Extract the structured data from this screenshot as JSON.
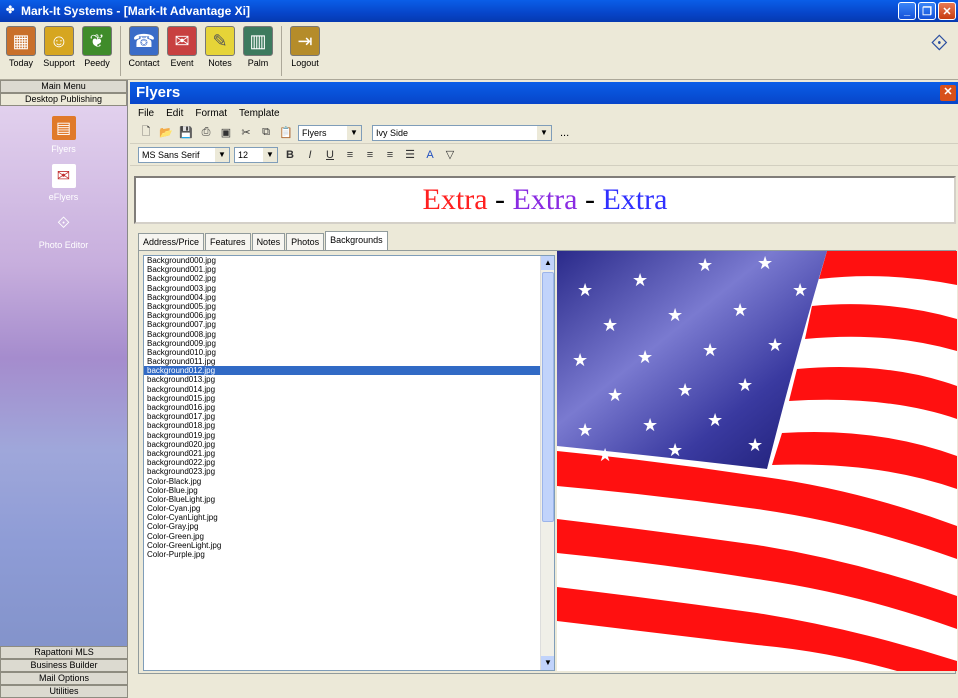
{
  "window": {
    "title": "Mark-It Systems - [Mark-It Advantage Xi]"
  },
  "toolbar": {
    "buttons": [
      {
        "label": "Today",
        "icon": "calendar-icon",
        "color": "#c9702a"
      },
      {
        "label": "Support",
        "icon": "support-icon",
        "color": "#d6a620"
      },
      {
        "label": "Peedy",
        "icon": "parrot-icon",
        "color": "#3f8c2a"
      },
      {
        "label": "Contact",
        "icon": "contact-icon",
        "color": "#3a6cc8"
      },
      {
        "label": "Event",
        "icon": "event-icon",
        "color": "#c84040"
      },
      {
        "label": "Notes",
        "icon": "notes-icon",
        "color": "#e6d438"
      },
      {
        "label": "Palm",
        "icon": "palm-icon",
        "color": "#3d7a5e"
      },
      {
        "label": "Logout",
        "icon": "logout-icon",
        "color": "#b58c2a"
      }
    ]
  },
  "sidebar": {
    "top_buttons": [
      "Main Menu",
      "Desktop Publishing"
    ],
    "items": [
      {
        "label": "Flyers",
        "icon": "flyers-icon"
      },
      {
        "label": "eFlyers",
        "icon": "eflyers-icon"
      },
      {
        "label": "Photo Editor",
        "icon": "photo-editor-icon"
      }
    ],
    "bottom_buttons": [
      "Rapattoni MLS",
      "Business Builder",
      "Mail Options",
      "Utilities"
    ]
  },
  "flyers": {
    "title": "Flyers",
    "menu": [
      "File",
      "Edit",
      "Format",
      "Template"
    ],
    "template_combo": "Flyers",
    "style_combo": "Ivy Side",
    "font_combo": "MS Sans Serif",
    "size_combo": "12",
    "more": "..."
  },
  "banner": {
    "word1": "Extra",
    "sep": " - ",
    "word2": "Extra",
    "word3": "Extra",
    "colors": [
      "#ff2020",
      "#8a2be2",
      "#3030ff"
    ]
  },
  "tabs": [
    "Address/Price",
    "Features",
    "Notes",
    "Photos",
    "Backgrounds"
  ],
  "active_tab": "Backgrounds",
  "backgrounds": [
    "Background000.jpg",
    "Background001.jpg",
    "Background002.jpg",
    "Background003.jpg",
    "Background004.jpg",
    "Background005.jpg",
    "Background006.jpg",
    "Background007.jpg",
    "Background008.jpg",
    "Background009.jpg",
    "Background010.jpg",
    "Background011.jpg",
    "background012.jpg",
    "background013.jpg",
    "background014.jpg",
    "background015.jpg",
    "background016.jpg",
    "background017.jpg",
    "background018.jpg",
    "background019.jpg",
    "background020.jpg",
    "background021.jpg",
    "background022.jpg",
    "background023.jpg",
    "Color-Black.jpg",
    "Color-Blue.jpg",
    "Color-BlueLight.jpg",
    "Color-Cyan.jpg",
    "Color-CyanLight.jpg",
    "Color-Gray.jpg",
    "Color-Green.jpg",
    "Color-GreenLight.jpg",
    "Color-Purple.jpg"
  ],
  "selected_background": "background012.jpg"
}
